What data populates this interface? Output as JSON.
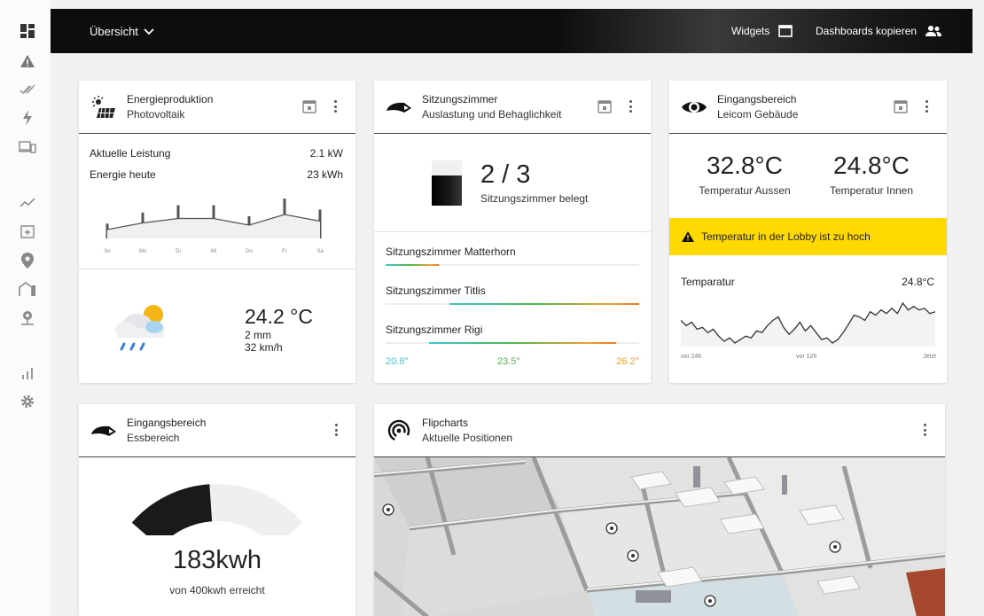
{
  "header": {
    "title": "Übersicht",
    "widgets_label": "Widgets",
    "copy_label": "Dashboards kopieren"
  },
  "sidebar": {
    "items": [
      "dashboard-icon",
      "warning-icon",
      "check-double-icon",
      "lightning-icon",
      "devices-icon",
      "trend-icon",
      "calendar-plus-icon",
      "location-pin-icon",
      "buildings-icon",
      "map-pin-icon",
      "bar-chart-icon",
      "gear-icon"
    ]
  },
  "energy": {
    "title": "Energieproduktion",
    "subtitle": "Photovoltaik",
    "power_label": "Aktuelle Leistung",
    "power_value": "2.1 kW",
    "today_label": "Energie heute",
    "today_value": "23 kWh",
    "days": [
      "So",
      "Mo",
      "Di",
      "Mi",
      "Do",
      "Fr",
      "Sa"
    ],
    "values": [
      2,
      3.5,
      4.5,
      4.5,
      3,
      5.4,
      3.9
    ],
    "weather_temp": "24.2 °C",
    "weather_rain": "2 mm",
    "weather_wind": "32 km/h"
  },
  "rooms": {
    "title": "Sitzungszimmer",
    "subtitle": "Auslastung und Behaglichkeit",
    "occupancy": "2 / 3",
    "occupancy_fraction": 0.67,
    "occupancy_label": "Sitzungszimmer belegt",
    "list": [
      {
        "name": "Sitzungszimmer Matterhorn",
        "from": 0,
        "to": 0.21
      },
      {
        "name": "Sitzungszimmer Titlis",
        "from": 0.25,
        "to": 1.0
      },
      {
        "name": "Sitzungszimmer Rigi",
        "from": 0.17,
        "to": 0.91
      }
    ],
    "scale_min": "20.8°",
    "scale_mid": "23.5°",
    "scale_max": "26.2°",
    "color_cool": "#3cc9d4",
    "color_mid": "#4cb84c",
    "color_warm": "#f0a030"
  },
  "entrance": {
    "title": "Eingangsbereich",
    "subtitle": "Leicom Gebäude",
    "temp_out": "32.8°C",
    "temp_out_label": "Temperatur Aussen",
    "temp_in": "24.8°C",
    "temp_in_label": "Temperatur Innen",
    "alert_text": "Temperatur in der Lobby ist zu hoch",
    "alert_color": "#ffd900",
    "chart_title": "Temparatur",
    "chart_value": "24.8°C",
    "chart_x_labels": [
      "vor 24h",
      "vor 12h",
      "Jetzt"
    ]
  },
  "temperature_chart": {
    "type": "line",
    "values": [
      23.9,
      23.6,
      23.8,
      23.4,
      23.5,
      23.2,
      23.4,
      23.0,
      22.7,
      22.9,
      22.6,
      22.8,
      23.0,
      22.9,
      23.3,
      23.2,
      23.6,
      23.9,
      24.1,
      23.5,
      23.1,
      23.4,
      23.8,
      23.3,
      23.6,
      23.2,
      22.8,
      22.9,
      22.6,
      22.8,
      23.2,
      23.7,
      24.2,
      24.1,
      23.9,
      24.4,
      24.2,
      24.5,
      24.3,
      24.6,
      24.3,
      24.9,
      24.5,
      24.7,
      24.5,
      24.6,
      24.3,
      24.4
    ]
  },
  "consumption": {
    "title": "Eingangsbereich",
    "subtitle": "Essbereich",
    "value": "183kwh",
    "caption": "von 400kwh erreicht",
    "fraction": 0.46
  },
  "flipcharts": {
    "title": "Flipcharts",
    "subtitle": "Aktuelle Positionen"
  }
}
